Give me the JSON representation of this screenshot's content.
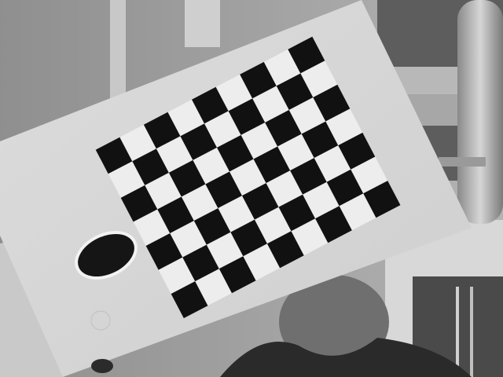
{
  "image": {
    "grayscale": true,
    "subject": "checkerboard-calibration-board",
    "checkerboard": {
      "rows": 7,
      "columns": 9,
      "dark_color": "#111111",
      "light_color": "#ededed"
    },
    "colors": {
      "wall": "#a9a9a9",
      "board": "#e4e4e4",
      "pipe": "#bdbdbd",
      "panel": "#4a4a4a"
    }
  }
}
